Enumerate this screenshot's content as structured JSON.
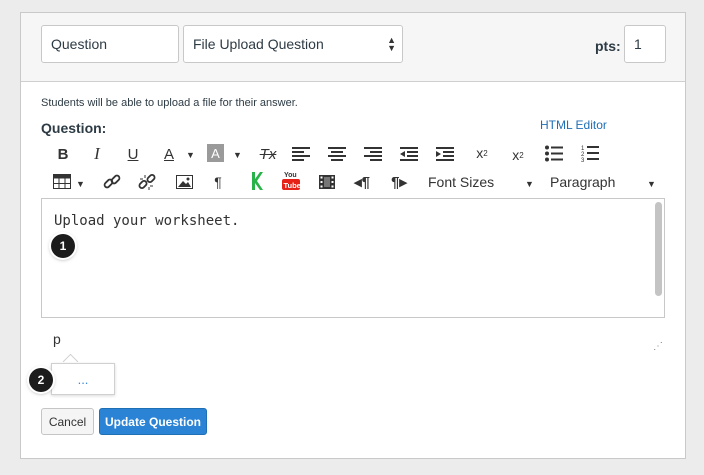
{
  "header": {
    "question_name": "Question",
    "question_type": "File Upload Question",
    "points_label": "pts:",
    "points_value": "1"
  },
  "description": "Students will be able to upload a file for their answer.",
  "question_label": "Question:",
  "html_editor_link": "HTML Editor",
  "toolbar": {
    "row1": [
      {
        "name": "bold-button",
        "icon": "B"
      },
      {
        "name": "italic-button",
        "icon": "I"
      },
      {
        "name": "underline-button",
        "icon": "U"
      },
      {
        "name": "text-color-button",
        "icon": "A"
      },
      {
        "name": "background-color-button",
        "icon": "A"
      },
      {
        "name": "clear-formatting-button",
        "icon": "Tx"
      },
      {
        "name": "align-left-button",
        "icon": "align-left"
      },
      {
        "name": "align-center-button",
        "icon": "align-center"
      },
      {
        "name": "align-right-button",
        "icon": "align-right"
      },
      {
        "name": "outdent-button",
        "icon": "outdent"
      },
      {
        "name": "indent-button",
        "icon": "indent"
      },
      {
        "name": "superscript-button",
        "icon": "x²"
      },
      {
        "name": "subscript-button",
        "icon": "x₂"
      },
      {
        "name": "bullet-list-button",
        "icon": "bullets"
      },
      {
        "name": "numbered-list-button",
        "icon": "numbers"
      }
    ],
    "row2_icons": [
      "table-icon",
      "link-icon",
      "unlink-icon",
      "image-icon",
      "paragraph-icon",
      "kaltura-icon",
      "youtube-icon",
      "media-icon",
      "ltr-icon",
      "rtl-icon"
    ],
    "font_sizes_label": "Font Sizes",
    "paragraph_label": "Paragraph",
    "youtube_text": "You Tube"
  },
  "editor": {
    "content": "Upload your worksheet."
  },
  "path_label": "p",
  "popup_text": "...",
  "callouts": [
    "1",
    "2"
  ],
  "buttons": {
    "cancel": "Cancel",
    "update": "Update Question"
  },
  "colors": {
    "accent": "#2a83d5",
    "link": "#1f6fb5",
    "youtube": "#e62117",
    "kaltura": "#2ab24a"
  }
}
